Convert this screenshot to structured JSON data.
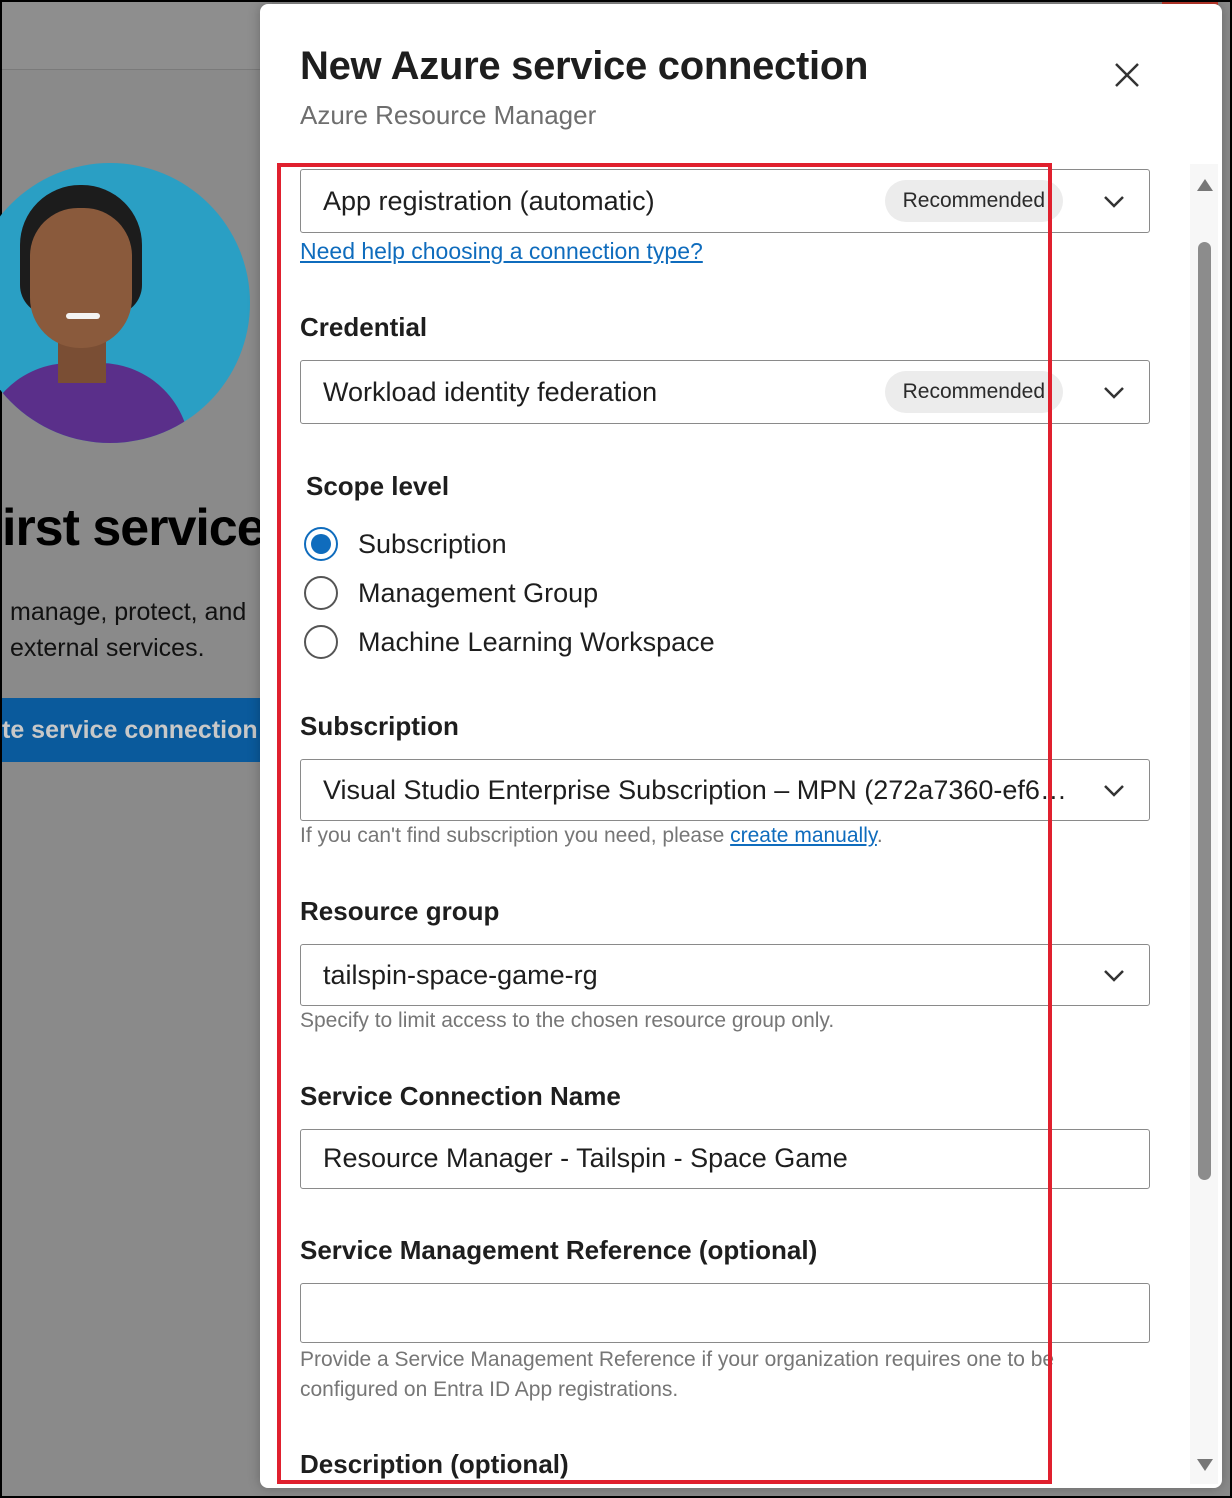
{
  "background": {
    "heading": "irst service",
    "line1": "manage, protect, and",
    "line2": "external services.",
    "button_label": "te service connection"
  },
  "panel": {
    "title": "New Azure service connection",
    "subtitle": "Azure Resource Manager",
    "close_icon": "close-icon"
  },
  "identity_type": {
    "value": "App registration (automatic)",
    "badge": "Recommended",
    "help_link": "Need help choosing a connection type?"
  },
  "credential": {
    "label": "Credential",
    "value": "Workload identity federation",
    "badge": "Recommended"
  },
  "scope": {
    "label": "Scope level",
    "options": [
      {
        "label": "Subscription",
        "checked": true
      },
      {
        "label": "Management Group",
        "checked": false
      },
      {
        "label": "Machine Learning Workspace",
        "checked": false
      }
    ]
  },
  "subscription": {
    "label": "Subscription",
    "value": "Visual Studio Enterprise Subscription – MPN (272a7360-ef6…",
    "help_prefix": "If you can't find subscription you need, please ",
    "help_link": "create manually",
    "help_suffix": "."
  },
  "resource_group": {
    "label": "Resource group",
    "value": "tailspin-space-game-rg",
    "help": "Specify to limit access to the chosen resource group only."
  },
  "service_connection_name": {
    "label": "Service Connection Name",
    "value": "Resource Manager - Tailspin - Space Game"
  },
  "service_management_reference": {
    "label": "Service Management Reference (optional)",
    "value": "",
    "help": "Provide a Service Management Reference if your organization requires one to be configured on Entra ID App registrations."
  },
  "description": {
    "label": "Description (optional)"
  },
  "colors": {
    "accent": "#0f6cbd",
    "highlight": "#e0202e"
  }
}
